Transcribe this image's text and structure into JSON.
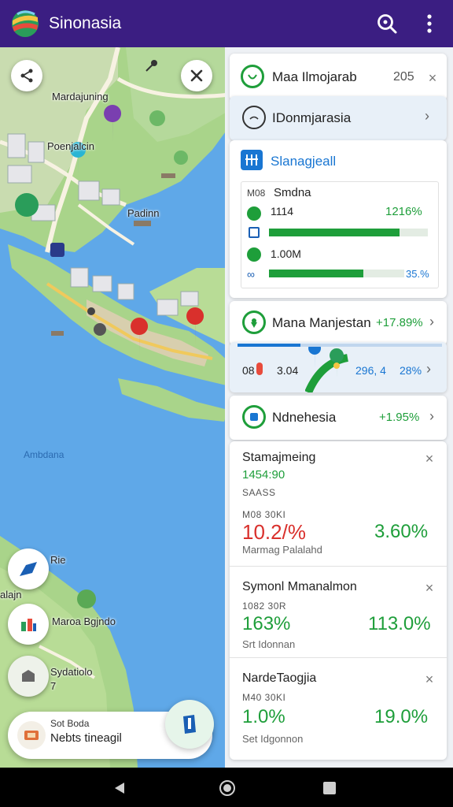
{
  "appbar": {
    "title": "Sinonasia",
    "logo_icon": "globe-logo",
    "search_icon": "search-icon",
    "more_icon": "more-vert-icon",
    "bg_color": "#3b1e82"
  },
  "map": {
    "labels": {
      "district1": "Mardajuning",
      "district2": "Poenjalcin",
      "district3": "Padinn",
      "water": "Ambdana",
      "poi_ride": "Rie",
      "poi_left": "alajn",
      "poi_park": "Maroa Bgjndo",
      "poi_stadio_1": "Sydatiolo",
      "poi_stadio_2": "7"
    },
    "bottom_card": {
      "line1": "Sot Boda",
      "line2": "Nebts tineagil"
    }
  },
  "panel": {
    "row1": {
      "title": "Maa Ilmojarab",
      "value": "205"
    },
    "row2": {
      "title": "IDonmjarasia"
    },
    "stats": {
      "title": "Slanagjeall",
      "header_a": "M08",
      "header_b": "Smdna",
      "row1_label": "1114",
      "row1_value": "1216%",
      "row1_fill": 0.82,
      "row2_label": "1.00M",
      "row2_value": "35.%",
      "row2_fill": 0.7
    },
    "row3": {
      "title": "Mana Manjestan",
      "value": "+17.89%"
    },
    "route": {
      "a": "08",
      "b": "3.04",
      "c": "296, 4",
      "d": "28%"
    },
    "row4": {
      "title": "Ndnehesia",
      "value": "+1.95%"
    },
    "entries": [
      {
        "name": "Stamajmeing",
        "code": "1454:90",
        "sub": "SAASS",
        "small": "M08 30KI",
        "big_left": "10.2/%",
        "big_right": "3.60%",
        "foot": "Marmag Palalahd"
      },
      {
        "name": "Symonl Mmanalmon",
        "code": "",
        "sub": "",
        "small": "1082 30R",
        "big_left": "163%",
        "big_right": "113.0%",
        "foot": "Srt Idonnan"
      },
      {
        "name": "NardeTaogjia",
        "code": "",
        "sub": "",
        "small": "M40 30KI",
        "big_left": "1.0%",
        "big_right": "19.0%",
        "foot": "Set Idgonnon"
      }
    ],
    "colors": {
      "green": "#1e9e3a",
      "red": "#d9302c",
      "blue": "#1976d2"
    }
  },
  "nav": {
    "back_icon": "back-triangle-icon",
    "home_icon": "home-circle-icon",
    "recents_icon": "recents-square-icon"
  }
}
